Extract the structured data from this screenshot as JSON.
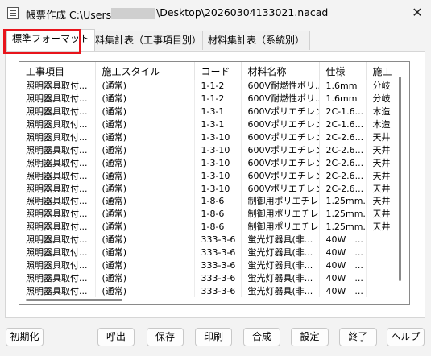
{
  "window": {
    "title_prefix": "帳票作成 C:\\Users",
    "title_suffix": "\\Desktop\\20260304133021.nacad",
    "close_glyph": "✕"
  },
  "tabs": [
    {
      "label": "標準フォーマット"
    },
    {
      "label": "材料集計表（工事項目別）"
    },
    {
      "label": "材料集計表（系統別）"
    }
  ],
  "grid": {
    "columns": [
      "工事項目",
      "施工スタイル",
      "コード",
      "材料名称",
      "仕様",
      "施工"
    ],
    "rows": [
      [
        "照明器具取付...",
        "(通常)",
        "1-1-2",
        "600V耐燃性ポリ...",
        "1.6mm",
        "分岐"
      ],
      [
        "照明器具取付...",
        "(通常)",
        "1-1-2",
        "600V耐燃性ポリ...",
        "1.6mm",
        "分岐"
      ],
      [
        "照明器具取付...",
        "(通常)",
        "1-3-1",
        "600Vポリエチレン...",
        "2C-1.6...",
        "木造"
      ],
      [
        "照明器具取付...",
        "(通常)",
        "1-3-1",
        "600Vポリエチレン...",
        "2C-1.6...",
        "木造"
      ],
      [
        "照明器具取付...",
        "(通常)",
        "1-3-10",
        "600Vポリエチレン...",
        "2C-2.6...",
        "天井"
      ],
      [
        "照明器具取付...",
        "(通常)",
        "1-3-10",
        "600Vポリエチレン...",
        "2C-2.6...",
        "天井"
      ],
      [
        "照明器具取付...",
        "(通常)",
        "1-3-10",
        "600Vポリエチレン...",
        "2C-2.6...",
        "天井"
      ],
      [
        "照明器具取付...",
        "(通常)",
        "1-3-10",
        "600Vポリエチレン...",
        "2C-2.6...",
        "天井"
      ],
      [
        "照明器具取付...",
        "(通常)",
        "1-3-10",
        "600Vポリエチレン...",
        "2C-2.6...",
        "天井"
      ],
      [
        "照明器具取付...",
        "(通常)",
        "1-8-6",
        "制御用ポリエチレ...",
        "1.25mm...",
        "天井"
      ],
      [
        "照明器具取付...",
        "(通常)",
        "1-8-6",
        "制御用ポリエチレ...",
        "1.25mm...",
        "天井"
      ],
      [
        "照明器具取付...",
        "(通常)",
        "1-8-6",
        "制御用ポリエチレ...",
        "1.25mm...",
        "天井"
      ],
      [
        "照明器具取付...",
        "(通常)",
        "333-3-6",
        "蛍光灯器具(非...",
        "40W　...",
        ""
      ],
      [
        "照明器具取付...",
        "(通常)",
        "333-3-6",
        "蛍光灯器具(非...",
        "40W　...",
        ""
      ],
      [
        "照明器具取付...",
        "(通常)",
        "333-3-6",
        "蛍光灯器具(非...",
        "40W　...",
        ""
      ],
      [
        "照明器具取付...",
        "(通常)",
        "333-3-6",
        "蛍光灯器具(非...",
        "40W　...",
        ""
      ],
      [
        "照明器具取付...",
        "(通常)",
        "333-3-6",
        "蛍光灯器具(非...",
        "40W　...",
        ""
      ]
    ]
  },
  "buttons": {
    "init": "初期化",
    "call": "呼出",
    "save": "保存",
    "print": "印刷",
    "combine": "合成",
    "settings": "設定",
    "exit": "終了",
    "help": "ヘルプ"
  },
  "colors": {
    "highlight": "#e8141b"
  }
}
